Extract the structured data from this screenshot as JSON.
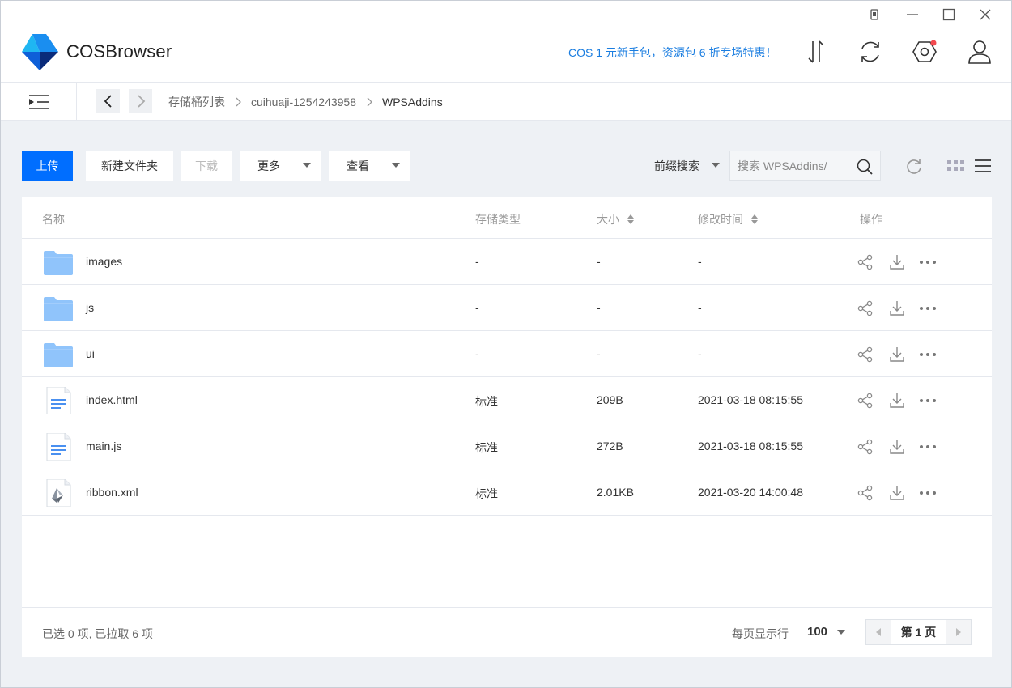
{
  "app": {
    "name": "COSBrowser",
    "promo": "COS 1 元新手包，资源包 6 折专场特惠！"
  },
  "breadcrumb": [
    "存储桶列表",
    "cuihuaji-1254243958",
    "WPSAddins"
  ],
  "toolbar": {
    "upload": "上传",
    "new_folder": "新建文件夹",
    "download": "下载",
    "more": "更多",
    "view": "查看",
    "search_mode": "前缀搜索",
    "search_placeholder": "搜索 WPSAddins/"
  },
  "table": {
    "columns": {
      "name": "名称",
      "storage_class": "存储类型",
      "size": "大小",
      "modified": "修改时间",
      "actions": "操作"
    },
    "rows": [
      {
        "name": "images",
        "type": "folder",
        "storage_class": "-",
        "size": "-",
        "modified": "-"
      },
      {
        "name": "js",
        "type": "folder",
        "storage_class": "-",
        "size": "-",
        "modified": "-"
      },
      {
        "name": "ui",
        "type": "folder",
        "storage_class": "-",
        "size": "-",
        "modified": "-"
      },
      {
        "name": "index.html",
        "type": "document",
        "storage_class": "标准",
        "size": "209B",
        "modified": "2021-03-18 08:15:55"
      },
      {
        "name": "main.js",
        "type": "document",
        "storage_class": "标准",
        "size": "272B",
        "modified": "2021-03-18 08:15:55"
      },
      {
        "name": "ribbon.xml",
        "type": "xml",
        "storage_class": "标准",
        "size": "2.01KB",
        "modified": "2021-03-20 14:00:48"
      }
    ]
  },
  "footer": {
    "selection": "已选 0 项, 已拉取 6 项",
    "per_page_label": "每页显示行",
    "per_page": "100",
    "current_page": "第 1 页"
  },
  "colors": {
    "primary": "#006eff",
    "promo": "#1a7de0",
    "folder": "#90c4fb",
    "badge": "#f2494f"
  }
}
